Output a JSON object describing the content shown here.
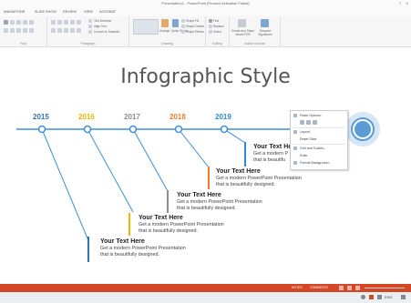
{
  "window": {
    "title": "Presentation1 - PowerPoint (Product Activation Failed)",
    "help": "?",
    "close": "X"
  },
  "ribbon_tabs": [
    "ANIMATIONS",
    "SLIDE SHOW",
    "REVIEW",
    "VIEW",
    "ACROBAT"
  ],
  "ribbon": {
    "groups": [
      "Font",
      "Paragraph",
      "Drawing",
      "Editing",
      "Adobe Acrobat"
    ],
    "paragraph_items": [
      "Text Direction",
      "Align Text",
      "Convert to SmartArt"
    ],
    "drawing_arrange": "Arrange",
    "drawing_quick_styles": "Quick Styles",
    "drawing_items": [
      "Shape Fill",
      "Shape Outline",
      "Shape Effects"
    ],
    "editing_items": [
      "Find",
      "Replace",
      "Select"
    ],
    "acrobat_items": [
      "Create and Share Adobe PDF",
      "Request Signatures"
    ]
  },
  "slide": {
    "title": "Infographic Style",
    "timeline": [
      {
        "year": "2015",
        "color": "#2E74B5"
      },
      {
        "year": "2016",
        "color": "#F5B400"
      },
      {
        "year": "2017",
        "color": "#8C8C8C"
      },
      {
        "year": "2018",
        "color": "#ED7D31"
      },
      {
        "year": "2019",
        "color": "#2E8BD8"
      }
    ],
    "line_color": "#3E8FD8",
    "entries": [
      {
        "title": "Your Text Here",
        "line1": "Get a modern PowerPoint  Presentation",
        "line2": "that is beautifully designed."
      },
      {
        "title": "Your Text Here",
        "line1": "Get a modern PowerPoint  Presentation",
        "line2": "that is beautifully designed."
      },
      {
        "title": "Your Text Here",
        "line1": "Get a modern PowerPoint  Presentation",
        "line2": "that is beautifully designed."
      },
      {
        "title": "Your Text Here",
        "line1": "Get a modern PowerPoint  Presentation",
        "line2": "that is beautifully designed."
      },
      {
        "title": "Your Text Here",
        "line1": "Get a modern P",
        "line2": "that is beautifu"
      }
    ]
  },
  "context_menu": {
    "paste_options": "Paste Options:",
    "items": [
      "Layout",
      "Reset Slide",
      "Grid and Guides...",
      "Ruler",
      "Format Background..."
    ]
  },
  "status_bar": {
    "notes": "NOTES",
    "comments": "COMMENTS"
  },
  "taskbar": {
    "lang": "ENG"
  }
}
